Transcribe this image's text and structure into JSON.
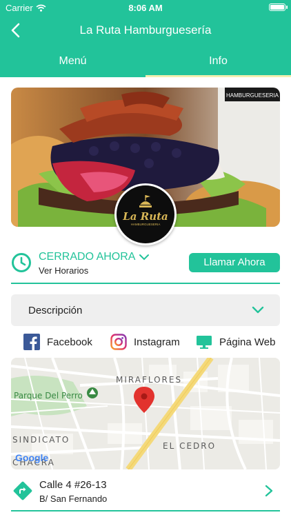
{
  "status_bar": {
    "carrier": "Carrier",
    "time": "8:06 AM"
  },
  "nav": {
    "title": "La Ruta Hamburguesería",
    "back_icon": "chevron-left-icon"
  },
  "tabs": [
    {
      "label": "Menú",
      "active": false
    },
    {
      "label": "Info",
      "active": true
    }
  ],
  "hero": {
    "logo_text": "La Ruta",
    "logo_subtext": "HAMBURGUESERIA",
    "sign_text": "HAMBURGUESERIA"
  },
  "hours": {
    "status": "CERRADO AHORA",
    "link": "Ver Horarios",
    "call_button": "Llamar Ahora"
  },
  "description": {
    "label": "Descripción"
  },
  "social": {
    "facebook": "Facebook",
    "instagram": "Instagram",
    "website": "Página Web"
  },
  "map": {
    "labels": {
      "miraflores": "MIRAFLORES",
      "park": "Parque Del Perro",
      "sindicato": "SINDICATO",
      "cedro": "EL CEDRO",
      "chacra": "CHACRA",
      "google": "Google"
    }
  },
  "address": {
    "line1": "Calle 4 #26-13",
    "line2": "B/ San Fernando"
  },
  "colors": {
    "accent": "#22c39a",
    "tab_indicator": "#f3efb0",
    "pin": "#e2332e"
  }
}
